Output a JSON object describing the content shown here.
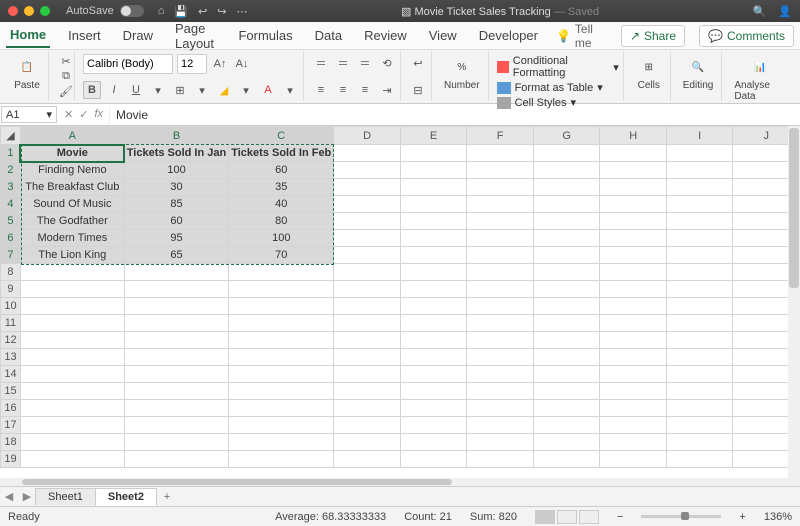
{
  "titlebar": {
    "autosave": "AutoSave",
    "doc_icon": "📄",
    "doc_name": "Movie Ticket Sales Tracking",
    "saved": "— Saved"
  },
  "tabs": [
    "Home",
    "Insert",
    "Draw",
    "Page Layout",
    "Formulas",
    "Data",
    "Review",
    "View",
    "Developer"
  ],
  "tell_me": "Tell me",
  "share": "Share",
  "comments": "Comments",
  "ribbon": {
    "paste": "Paste",
    "font_name": "Calibri (Body)",
    "font_size": "12",
    "number": "Number",
    "cf": "Conditional Formatting",
    "fat": "Format as Table",
    "cs": "Cell Styles",
    "cells": "Cells",
    "editing": "Editing",
    "analyse": "Analyse Data"
  },
  "namebox": "A1",
  "formula": "Movie",
  "columns": [
    "A",
    "B",
    "C",
    "D",
    "E",
    "F",
    "G",
    "H",
    "I",
    "J"
  ],
  "headers": {
    "a": "Movie",
    "b": "Tickets Sold In Jan",
    "c": "Tickets Sold In Feb"
  },
  "rows": [
    {
      "a": "Finding Nemo",
      "b": "100",
      "c": "60"
    },
    {
      "a": "The Breakfast Club",
      "b": "30",
      "c": "35"
    },
    {
      "a": "Sound Of Music",
      "b": "85",
      "c": "40"
    },
    {
      "a": "The Godfather",
      "b": "60",
      "c": "80"
    },
    {
      "a": "Modern Times",
      "b": "95",
      "c": "100"
    },
    {
      "a": "The Lion King",
      "b": "65",
      "c": "70"
    }
  ],
  "sheets": [
    "Sheet1",
    "Sheet2"
  ],
  "status": {
    "ready": "Ready",
    "avg": "Average: 68.33333333",
    "count": "Count: 21",
    "sum": "Sum: 820",
    "zoom": "136%"
  },
  "chart_data": {
    "type": "table",
    "title": "Movie Ticket Sales Tracking",
    "columns": [
      "Movie",
      "Tickets Sold In Jan",
      "Tickets Sold In Feb"
    ],
    "rows": [
      [
        "Finding Nemo",
        100,
        60
      ],
      [
        "The Breakfast Club",
        30,
        35
      ],
      [
        "Sound Of Music",
        85,
        40
      ],
      [
        "The Godfather",
        60,
        80
      ],
      [
        "Modern Times",
        95,
        100
      ],
      [
        "The Lion King",
        65,
        70
      ]
    ]
  }
}
